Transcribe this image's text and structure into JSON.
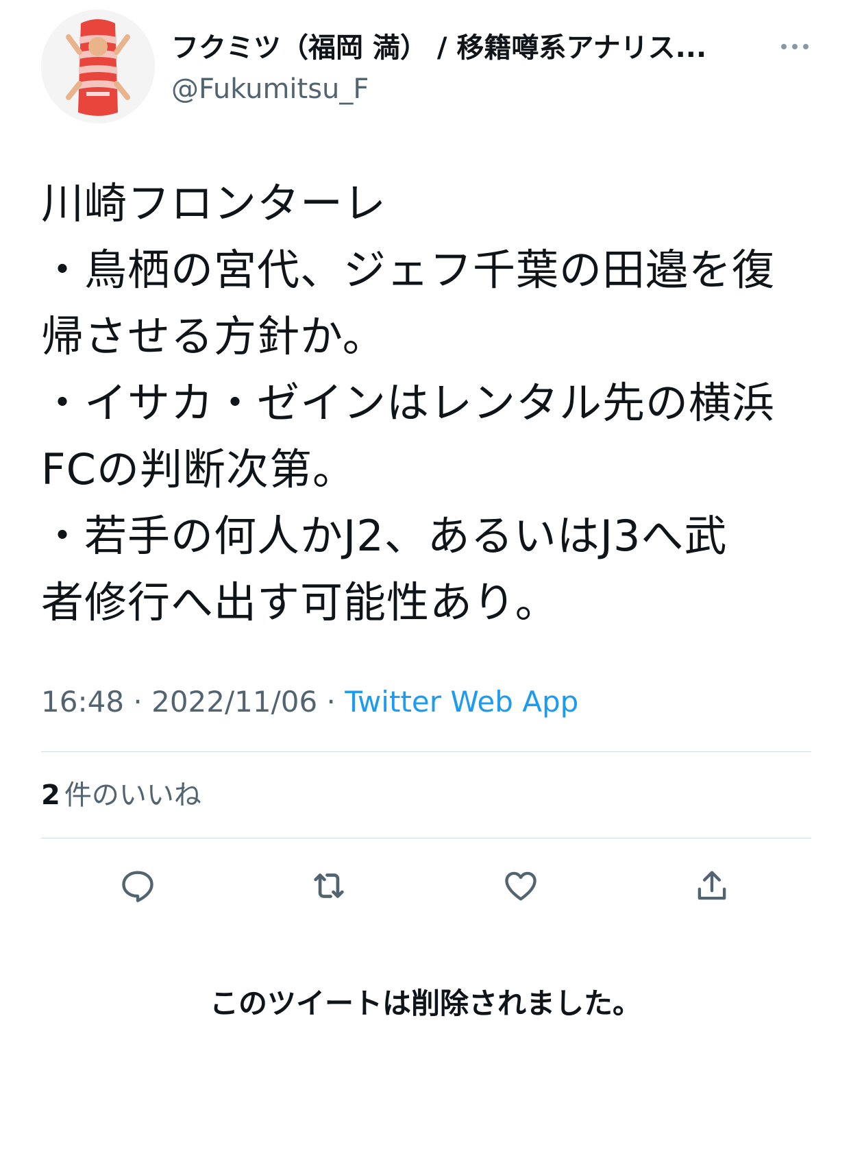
{
  "user": {
    "display_name": "フクミツ（福岡 満） / 移籍噂系アナリス...",
    "handle": "@Fukumitsu_F",
    "avatar_icon": "user-avatar-photo"
  },
  "tweet": {
    "lines": [
      "川崎フロンターレ",
      "・鳥栖の宮代、ジェフ千葉の田邉を復",
      "帰させる方針か。",
      "・イサカ・ゼインはレンタル先の横浜",
      "FCの判断次第。",
      "・若手の何人かJ2、あるいはJ3へ武",
      "者修行へ出す可能性あり。"
    ]
  },
  "meta": {
    "time": "16:48",
    "separator": " · ",
    "date": "2022/11/06",
    "source": "Twitter Web App"
  },
  "likes": {
    "count": "2",
    "label": "件のいいね"
  },
  "actions": [
    {
      "name": "reply",
      "icon": "reply-icon"
    },
    {
      "name": "retweet",
      "icon": "retweet-icon"
    },
    {
      "name": "like",
      "icon": "heart-icon"
    },
    {
      "name": "share",
      "icon": "share-icon"
    }
  ],
  "deleted_notice": "このツイートは削除されました。",
  "colors": {
    "text": "#0f1419",
    "secondary": "#536471",
    "link": "#1d9bf0",
    "divider": "#cfd9de"
  }
}
